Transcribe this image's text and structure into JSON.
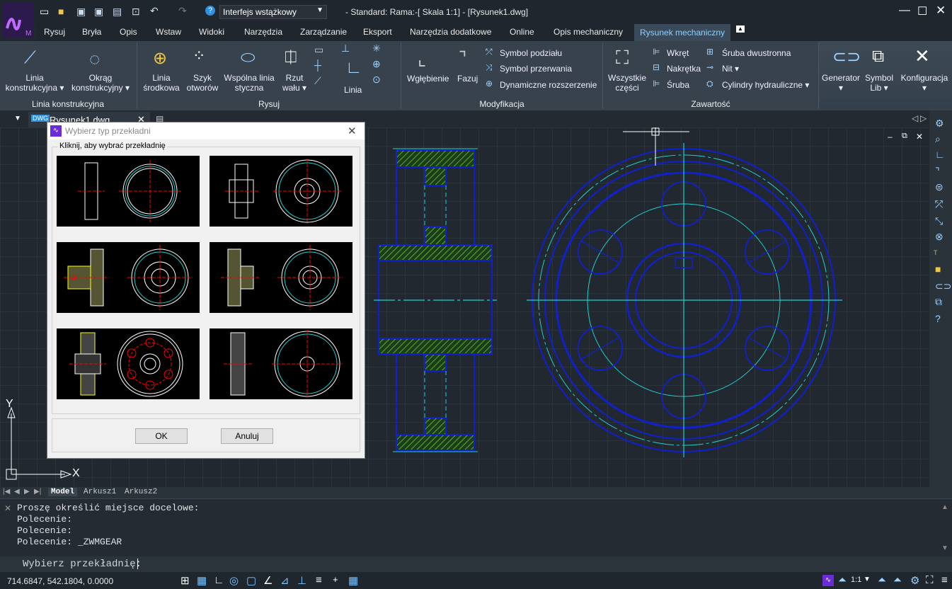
{
  "title": {
    "workspace": "Interfejs wstążkowy",
    "window_title": "- Standard: Rama:-[ Skala 1:1] - [Rysunek1.dwg]"
  },
  "menu_tabs": [
    {
      "label": "Rysuj"
    },
    {
      "label": "Bryła"
    },
    {
      "label": "Opis"
    },
    {
      "label": "Wstaw"
    },
    {
      "label": "Widoki"
    },
    {
      "label": "Narzędzia"
    },
    {
      "label": "Zarządzanie"
    },
    {
      "label": "Eksport"
    },
    {
      "label": "Narzędzia dodatkowe"
    },
    {
      "label": "Online"
    },
    {
      "label": "Opis mechaniczny"
    },
    {
      "label": "Rysunek mechaniczny"
    }
  ],
  "ribbon": {
    "linia_konstrukcyjna": {
      "l1": "Linia",
      "l2": "konstrukcyjna ▾"
    },
    "okrag": {
      "l1": "Okrąg",
      "l2": "konstrukcyjny ▾"
    },
    "linia_srodkowa": {
      "l1": "Linia",
      "l2": "środkowa"
    },
    "szyk": {
      "l1": "Szyk",
      "l2": "otworów"
    },
    "wspolna": {
      "l1": "Wspólna linia",
      "l2": "styczna"
    },
    "rzut": {
      "l1": "Rzut",
      "l2": "wału ▾"
    },
    "linia": "Linia",
    "wglebienie": "Wgłębienie",
    "fazuj": "Fazuj",
    "symbol_podzialu": "Symbol podziału",
    "symbol_przerwania": "Symbol przerwania",
    "dynamiczne": "Dynamiczne rozszerzenie",
    "wszystkie": {
      "l1": "Wszystkie",
      "l2": "części"
    },
    "wkret": "Wkręt",
    "nakretka": "Nakrętka",
    "sruba": "Śruba",
    "sruba_dw": "Śruba dwustronna",
    "nit": "Nit",
    "cylindry": "Cylindry hydrauliczne",
    "generator": "Generator",
    "symbol_lib": {
      "l1": "Symbol",
      "l2": "Lib ▾"
    },
    "konfiguracja": "Konfiguracja",
    "groups": {
      "g1": "Linia konstrukcyjna",
      "g2": "Rysuj",
      "g3": "Modyfikacja",
      "g4": "Zawartość"
    }
  },
  "doc_tab": "Rysunek1.dwg",
  "ucs": {
    "x": "X",
    "y": "Y"
  },
  "layout_tabs": [
    {
      "label": "Model"
    },
    {
      "label": "Arkusz1"
    },
    {
      "label": "Arkusz2"
    }
  ],
  "command_history": [
    "Proszę określić miejsce docelowe:",
    "Polecenie:",
    "Polecenie:",
    "Polecenie: _ZWMGEAR"
  ],
  "command_prompt": "Wybierz przekładnię:",
  "coordinates": "714.6847, 542.1804, 0.0000",
  "scale": "1:1",
  "dialog": {
    "title": "Wybierz typ przekładni",
    "group_label": "Kliknij, aby wybrać przekładnię",
    "ok": "OK",
    "cancel": "Anuluj"
  }
}
